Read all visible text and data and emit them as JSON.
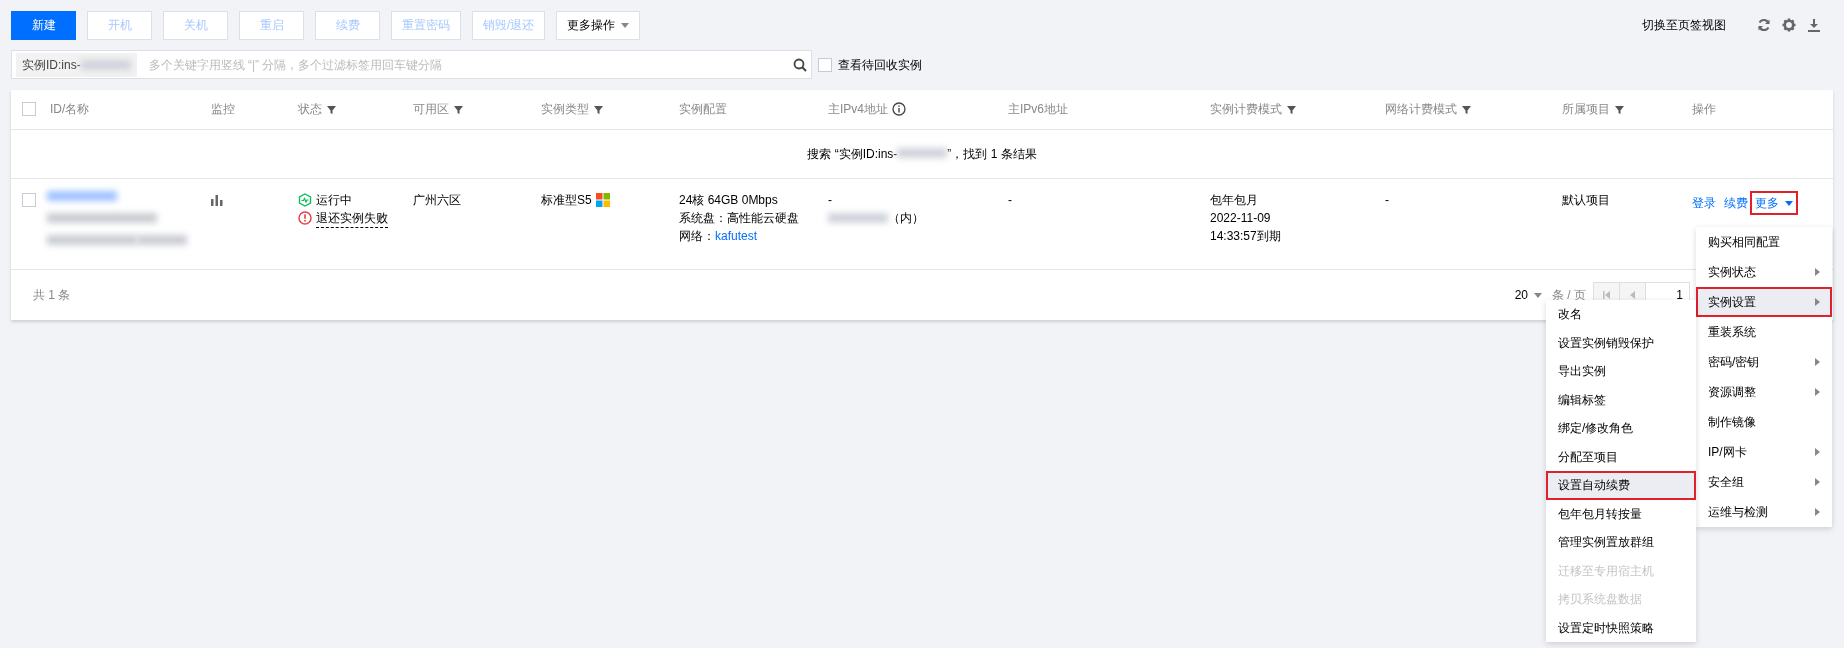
{
  "toolbar": {
    "buttons": [
      {
        "label": "新建",
        "kind": "primary"
      },
      {
        "label": "开机",
        "kind": "disabled"
      },
      {
        "label": "关机",
        "kind": "disabled"
      },
      {
        "label": "重启",
        "kind": "disabled"
      },
      {
        "label": "续费",
        "kind": "disabled"
      },
      {
        "label": "重置密码",
        "kind": "disabled"
      },
      {
        "label": "销毁/退还",
        "kind": "disabled"
      },
      {
        "label": "更多操作",
        "kind": "dropdown"
      }
    ],
    "view_switch": "切换至页签视图"
  },
  "search": {
    "tag": "实例ID:ins-",
    "placeholder": "多个关键字用竖线 “|” 分隔，多个过滤标签用回车键分隔"
  },
  "recycle_checkbox": {
    "label": "查看待回收实例",
    "checked": false
  },
  "table": {
    "select_all_checked": false,
    "columns": [
      {
        "label": "ID/名称",
        "filter": false,
        "info": false
      },
      {
        "label": "监控",
        "filter": false,
        "info": false
      },
      {
        "label": "状态",
        "filter": true,
        "info": false
      },
      {
        "label": "可用区",
        "filter": true,
        "info": false
      },
      {
        "label": "实例类型",
        "filter": true,
        "info": false
      },
      {
        "label": "实例配置",
        "filter": false,
        "info": false
      },
      {
        "label": "主IPv4地址",
        "filter": false,
        "info": true
      },
      {
        "label": "主IPv6地址",
        "filter": false,
        "info": false
      },
      {
        "label": "实例计费模式",
        "filter": true,
        "info": false
      },
      {
        "label": "网络计费模式",
        "filter": true,
        "info": false
      },
      {
        "label": "所属项目",
        "filter": true,
        "info": false
      },
      {
        "label": "操作",
        "filter": false,
        "info": false
      }
    ],
    "result_prefix": "搜索 “实例ID:ins-",
    "result_suffix": "”，找到 1 条结果",
    "rows": [
      {
        "checked": false,
        "status": [
          {
            "kind": "running",
            "text": "运行中"
          },
          {
            "kind": "error",
            "text": "退还实例失败"
          }
        ],
        "zone": "广州六区",
        "type": "标准型S5",
        "config": [
          "24核 64GB 0Mbps",
          "系统盘：高性能云硬盘"
        ],
        "network_label": "网络：",
        "network": "kafutest",
        "ipv4": "-",
        "ipv4_suffix": "（内）",
        "ipv6": "-",
        "billing": [
          "包年包月",
          "2022-11-09",
          "14:33:57到期"
        ],
        "net_billing": "-",
        "project": "默认项目",
        "actions": [
          "登录",
          "续费"
        ],
        "more": {
          "label": "更多",
          "highlighted": true
        }
      }
    ],
    "footer": {
      "total": "共 1 条",
      "page_size": "20",
      "per_page": "条 / 页",
      "page": "1"
    }
  },
  "menu": {
    "items": [
      {
        "label": "购买相同配置",
        "submenu": false,
        "highlighted": false
      },
      {
        "label": "实例状态",
        "submenu": true,
        "highlighted": false
      },
      {
        "label": "实例设置",
        "submenu": true,
        "highlighted": true
      },
      {
        "label": "重装系统",
        "submenu": false,
        "highlighted": false
      },
      {
        "label": "密码/密钥",
        "submenu": true,
        "highlighted": false
      },
      {
        "label": "资源调整",
        "submenu": true,
        "highlighted": false
      },
      {
        "label": "制作镜像",
        "submenu": false,
        "highlighted": false
      },
      {
        "label": "IP/网卡",
        "submenu": true,
        "highlighted": false
      },
      {
        "label": "安全组",
        "submenu": true,
        "highlighted": false
      },
      {
        "label": "运维与检测",
        "submenu": true,
        "highlighted": false
      }
    ]
  },
  "submenu": {
    "items": [
      {
        "label": "改名",
        "disabled": false,
        "highlighted": false
      },
      {
        "label": "设置实例销毁保护",
        "disabled": false,
        "highlighted": false
      },
      {
        "label": "导出实例",
        "disabled": false,
        "highlighted": false
      },
      {
        "label": "编辑标签",
        "disabled": false,
        "highlighted": false
      },
      {
        "label": "绑定/修改角色",
        "disabled": false,
        "highlighted": false
      },
      {
        "label": "分配至项目",
        "disabled": false,
        "highlighted": false
      },
      {
        "label": "设置自动续费",
        "disabled": false,
        "highlighted": true
      },
      {
        "label": "包年包月转按量",
        "disabled": false,
        "highlighted": false
      },
      {
        "label": "管理实例置放群组",
        "disabled": false,
        "highlighted": false
      },
      {
        "label": "迁移至专用宿主机",
        "disabled": true,
        "highlighted": false
      },
      {
        "label": "拷贝系统盘数据",
        "disabled": true,
        "highlighted": false
      },
      {
        "label": "设置定时快照策略",
        "disabled": false,
        "highlighted": false
      }
    ]
  }
}
